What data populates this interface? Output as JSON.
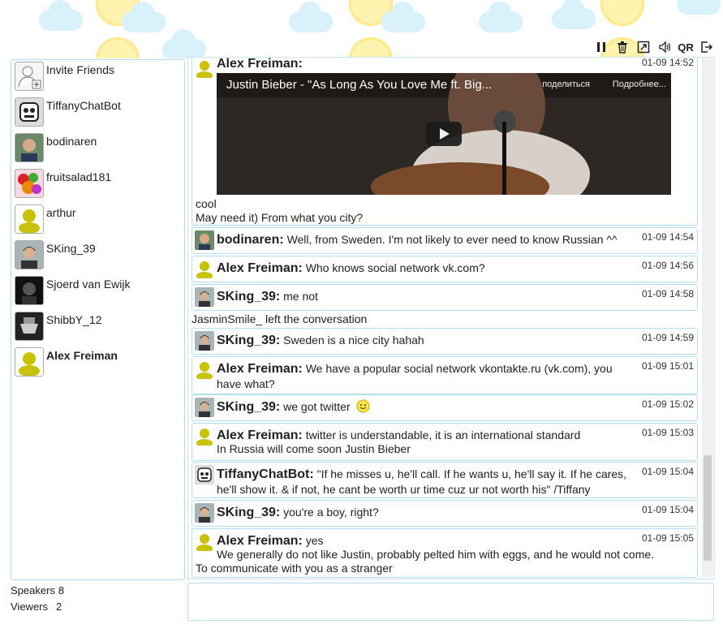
{
  "toolbar": {
    "icons": [
      "pause-icon",
      "trash-icon",
      "popout-icon",
      "speaker-icon",
      "qr-label",
      "exit-icon"
    ],
    "qr_label": "QR"
  },
  "sidebar": {
    "users": [
      {
        "name": "Invite Friends",
        "avatar": "invite-icon",
        "bold": false
      },
      {
        "name": "TiffanyChatBot",
        "avatar": "robot-avatar",
        "bold": false
      },
      {
        "name": "bodinaren",
        "avatar": "photo-avatar",
        "bold": false
      },
      {
        "name": "fruitsalad181",
        "avatar": "fruit-avatar",
        "bold": false
      },
      {
        "name": "arthur",
        "avatar": "default-avatar",
        "bold": false
      },
      {
        "name": "SKing_39",
        "avatar": "photo-avatar",
        "bold": false
      },
      {
        "name": "Sjoerd van Ewijk",
        "avatar": "dark-avatar",
        "bold": false
      },
      {
        "name": "ShibbY_12",
        "avatar": "dark-avatar",
        "bold": false
      },
      {
        "name": "Alex Freiman",
        "avatar": "default-avatar",
        "bold": true
      }
    ]
  },
  "counts": {
    "speakers_label": "Speakers",
    "speakers": "8",
    "viewers_label": "Viewers",
    "viewers": "2"
  },
  "chat": {
    "video": {
      "title": "Justin Bieber - \"As Long As You Love Me ft. Big...",
      "share": "поделиться",
      "more": "Подробнее..."
    },
    "messages": [
      {
        "author": "Alex Freiman:",
        "text": "",
        "time": "01-09 14:52",
        "extra": [
          "cool",
          "May need it) From what you city?"
        ]
      },
      {
        "author": "bodinaren:",
        "text": "Well, from Sweden. I'm not likely to ever need to know Russian ^^",
        "time": "01-09 14:54",
        "extra": []
      },
      {
        "author": "Alex Freiman:",
        "text": "Who knows social network vk.com?",
        "time": "01-09 14:56",
        "extra": []
      },
      {
        "author": "SKing_39:",
        "text": "me not",
        "time": "01-09 14:58",
        "extra": []
      },
      {
        "author": "SKing_39:",
        "text": "Sweden is a nice city hahah",
        "time": "01-09 14:59",
        "extra": []
      },
      {
        "author": "Alex Freiman:",
        "text": "We have a popular social network vkontakte.ru (vk.com), you have what?",
        "time": "01-09 15:01",
        "extra": []
      },
      {
        "author": "SKing_39:",
        "text": "we got twitter",
        "time": "01-09 15:02",
        "extra": []
      },
      {
        "author": "Alex Freiman:",
        "text": "twitter is understandable, it is an international standard",
        "time": "01-09 15:03",
        "extra": [
          "In Russia will come soon Justin Bieber"
        ]
      },
      {
        "author": "TiffanyChatBot:",
        "text": "\"If he misses u, he'll call. If he wants u, he'll say it. If he cares, he'll show it. & if not, he cant be worth ur time cuz ur not worth his\" /Tiffany",
        "time": "01-09 15:04",
        "extra": []
      },
      {
        "author": "SKing_39:",
        "text": "you're a boy, right?",
        "time": "01-09 15:04",
        "extra": []
      },
      {
        "author": "Alex Freiman:",
        "text": "yes",
        "time": "01-09 15:05",
        "extra": [
          "We generally do not like Justin, probably pelted him with eggs, and he would not come.",
          "To communicate with you as a stranger"
        ]
      }
    ],
    "system_message": "JasminSmile_ left the conversation"
  }
}
